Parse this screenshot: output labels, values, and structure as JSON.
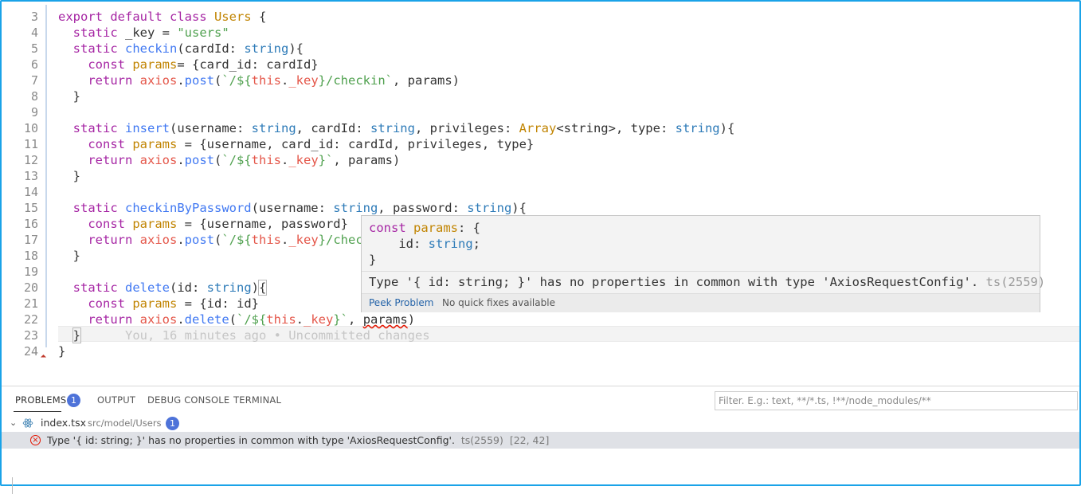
{
  "editor": {
    "lines": [
      {
        "num": "3",
        "tokens": [
          {
            "t": "export default class ",
            "c": "kw"
          },
          {
            "t": "Users",
            "c": "ty"
          },
          {
            "t": " {",
            "c": "pl"
          }
        ]
      },
      {
        "num": "4",
        "tokens": [
          {
            "t": "  static ",
            "c": "kw"
          },
          {
            "t": "_key = ",
            "c": "pl"
          },
          {
            "t": "\"users\"",
            "c": "str"
          }
        ]
      },
      {
        "num": "5",
        "tokens": [
          {
            "t": "  static ",
            "c": "kw"
          },
          {
            "t": "checkin",
            "c": "fn"
          },
          {
            "t": "(cardId: ",
            "c": "pl"
          },
          {
            "t": "string",
            "c": "tk"
          },
          {
            "t": "){",
            "c": "pl"
          }
        ]
      },
      {
        "num": "6",
        "tokens": [
          {
            "t": "    const ",
            "c": "kw"
          },
          {
            "t": "params",
            "c": "ty"
          },
          {
            "t": "= {card_id: cardId}",
            "c": "pl"
          }
        ]
      },
      {
        "num": "7",
        "tokens": [
          {
            "t": "    return ",
            "c": "kw"
          },
          {
            "t": "axios",
            "c": "thiskw"
          },
          {
            "t": ".",
            "c": "pl"
          },
          {
            "t": "post",
            "c": "fn"
          },
          {
            "t": "(",
            "c": "pl"
          },
          {
            "t": "`/${",
            "c": "str"
          },
          {
            "t": "this",
            "c": "thiskw"
          },
          {
            "t": ".",
            "c": "pl"
          },
          {
            "t": "_key",
            "c": "thiskw"
          },
          {
            "t": "}/checkin`",
            "c": "str"
          },
          {
            "t": ", params)",
            "c": "pl"
          }
        ]
      },
      {
        "num": "8",
        "tokens": [
          {
            "t": "  }",
            "c": "pl"
          }
        ]
      },
      {
        "num": "9",
        "tokens": []
      },
      {
        "num": "10",
        "tokens": [
          {
            "t": "  static ",
            "c": "kw"
          },
          {
            "t": "insert",
            "c": "fn"
          },
          {
            "t": "(username: ",
            "c": "pl"
          },
          {
            "t": "string",
            "c": "tk"
          },
          {
            "t": ", cardId: ",
            "c": "pl"
          },
          {
            "t": "string",
            "c": "tk"
          },
          {
            "t": ", privileges: ",
            "c": "pl"
          },
          {
            "t": "Array",
            "c": "ty"
          },
          {
            "t": "<string>, type: ",
            "c": "pl"
          },
          {
            "t": "string",
            "c": "tk"
          },
          {
            "t": "){",
            "c": "pl"
          }
        ]
      },
      {
        "num": "11",
        "tokens": [
          {
            "t": "    const ",
            "c": "kw"
          },
          {
            "t": "params",
            "c": "ty"
          },
          {
            "t": " = {username, card_id: cardId, privileges, type}",
            "c": "pl"
          }
        ]
      },
      {
        "num": "12",
        "tokens": [
          {
            "t": "    return ",
            "c": "kw"
          },
          {
            "t": "axios",
            "c": "thiskw"
          },
          {
            "t": ".",
            "c": "pl"
          },
          {
            "t": "post",
            "c": "fn"
          },
          {
            "t": "(",
            "c": "pl"
          },
          {
            "t": "`/${",
            "c": "str"
          },
          {
            "t": "this",
            "c": "thiskw"
          },
          {
            "t": ".",
            "c": "pl"
          },
          {
            "t": "_key",
            "c": "thiskw"
          },
          {
            "t": "}`",
            "c": "str"
          },
          {
            "t": ", params)",
            "c": "pl"
          }
        ]
      },
      {
        "num": "13",
        "tokens": [
          {
            "t": "  }",
            "c": "pl"
          }
        ]
      },
      {
        "num": "14",
        "tokens": []
      },
      {
        "num": "15",
        "tokens": [
          {
            "t": "  static ",
            "c": "kw"
          },
          {
            "t": "checkinByPassword",
            "c": "fn"
          },
          {
            "t": "(username: ",
            "c": "pl"
          },
          {
            "t": "string",
            "c": "tk"
          },
          {
            "t": ", password: ",
            "c": "pl"
          },
          {
            "t": "string",
            "c": "tk"
          },
          {
            "t": "){",
            "c": "pl"
          }
        ]
      },
      {
        "num": "16",
        "tokens": [
          {
            "t": "    const ",
            "c": "kw"
          },
          {
            "t": "params",
            "c": "ty"
          },
          {
            "t": " = {username, password}",
            "c": "pl"
          }
        ]
      },
      {
        "num": "17",
        "tokens": [
          {
            "t": "    return ",
            "c": "kw"
          },
          {
            "t": "axios",
            "c": "thiskw"
          },
          {
            "t": ".",
            "c": "pl"
          },
          {
            "t": "post",
            "c": "fn"
          },
          {
            "t": "(",
            "c": "pl"
          },
          {
            "t": "`/${",
            "c": "str"
          },
          {
            "t": "this",
            "c": "thiskw"
          },
          {
            "t": ".",
            "c": "pl"
          },
          {
            "t": "_key",
            "c": "thiskw"
          },
          {
            "t": "}/chec",
            "c": "str"
          }
        ]
      },
      {
        "num": "18",
        "tokens": [
          {
            "t": "  }",
            "c": "pl"
          }
        ]
      },
      {
        "num": "19",
        "tokens": []
      },
      {
        "num": "20",
        "tokens": [
          {
            "t": "  static ",
            "c": "kw"
          },
          {
            "t": "delete",
            "c": "fn"
          },
          {
            "t": "(id: ",
            "c": "pl"
          },
          {
            "t": "string",
            "c": "tk"
          },
          {
            "t": ")",
            "c": "pl"
          },
          {
            "t": "{",
            "c": "pl box"
          }
        ]
      },
      {
        "num": "21",
        "tokens": [
          {
            "t": "    const ",
            "c": "kw"
          },
          {
            "t": "params",
            "c": "ty"
          },
          {
            "t": " = {id: id}",
            "c": "pl"
          }
        ]
      },
      {
        "num": "22",
        "tokens": [
          {
            "t": "    return ",
            "c": "kw"
          },
          {
            "t": "axios",
            "c": "thiskw"
          },
          {
            "t": ".",
            "c": "pl"
          },
          {
            "t": "delete",
            "c": "fn"
          },
          {
            "t": "(",
            "c": "pl"
          },
          {
            "t": "`/${",
            "c": "str"
          },
          {
            "t": "this",
            "c": "thiskw"
          },
          {
            "t": ".",
            "c": "pl"
          },
          {
            "t": "_key",
            "c": "thiskw"
          },
          {
            "t": "}`",
            "c": "str"
          },
          {
            "t": ", ",
            "c": "pl"
          },
          {
            "t": "params",
            "c": "pl squig"
          },
          {
            "t": ")",
            "c": "pl"
          }
        ]
      },
      {
        "num": "23",
        "tokens": [
          {
            "t": "  ",
            "c": "pl"
          },
          {
            "t": "}",
            "c": "pl box"
          },
          {
            "t": "      You, 16 minutes ago • Uncommitted changes",
            "c": "blame"
          }
        ]
      },
      {
        "num": "24",
        "tokens": [
          {
            "t": "}",
            "c": "pl"
          }
        ]
      }
    ]
  },
  "hover": {
    "code_line1_kw": "const ",
    "code_line1_name": "params",
    "code_line1_rest": ": {",
    "code_line2_prop": "    id: ",
    "code_line2_type": "string",
    "code_line2_end": ";",
    "code_line3": "}",
    "message": "Type '{ id: string; }' has no properties in common with type 'AxiosRequestConfig'.",
    "message_code": " ts(2559)",
    "peek_label": "Peek Problem",
    "no_fixes_label": "No quick fixes available"
  },
  "panel": {
    "tabs": {
      "problems": "PROBLEMS",
      "output": "OUTPUT",
      "debug_console": "DEBUG CONSOLE",
      "terminal": "TERMINAL"
    },
    "problems_count": "1",
    "filter_placeholder": "Filter. E.g.: text, **/*.ts, !**/node_modules/**",
    "file": {
      "name": "index.tsx",
      "path": "src/model/Users",
      "count": "1"
    },
    "error": {
      "message": "Type '{ id: string; }' has no properties in common with type 'AxiosRequestConfig'.",
      "code": "ts(2559)",
      "location": "[22, 42]"
    }
  },
  "colors": {
    "accent": "#1aa3e8",
    "badge": "#4e73d9",
    "error": "#e51400"
  }
}
